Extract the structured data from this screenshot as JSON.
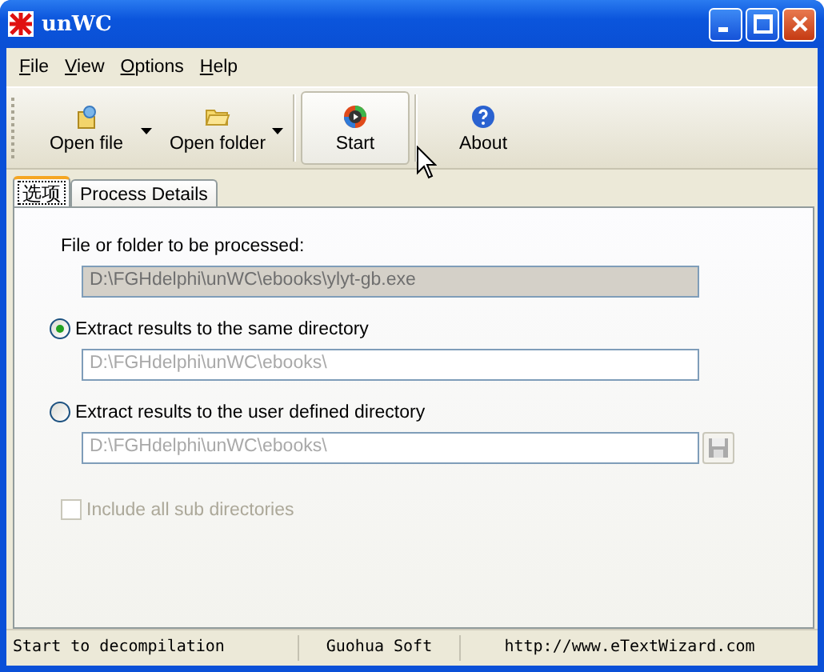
{
  "window": {
    "title": "unWC"
  },
  "menu": [
    {
      "label": "File"
    },
    {
      "label": "View"
    },
    {
      "label": "Options"
    },
    {
      "label": "Help"
    }
  ],
  "toolbar": [
    {
      "label": "Open file",
      "kind": "split",
      "hot": false
    },
    {
      "label": "Open folder",
      "kind": "split",
      "hot": false
    },
    {
      "label": "Start",
      "kind": "plain",
      "hot": true
    },
    {
      "label": "About",
      "kind": "plain",
      "hot": false
    }
  ],
  "tabs": [
    {
      "label": "选项",
      "selected": true
    },
    {
      "label": "Process Details",
      "selected": false
    }
  ],
  "options": {
    "source_label": "File or folder to be processed:",
    "source_value": "D:\\FGHdelphi\\unWC\\ebooks\\ylyt-gb.exe",
    "targets": [
      {
        "label": "Extract results to the same directory",
        "selected": true,
        "value": "D:\\FGHdelphi\\unWC\\ebooks\\",
        "browse": false
      },
      {
        "label": "Extract results to the user defined directory",
        "selected": false,
        "value": "D:\\FGHdelphi\\unWC\\ebooks\\",
        "browse": true
      }
    ],
    "subdirs": {
      "label": "Include all sub directories",
      "checked": false,
      "disabled": true
    }
  },
  "status_bar": [
    "Start to decompilation",
    "Guohua Soft",
    "http://www.eTextWizard.com"
  ]
}
